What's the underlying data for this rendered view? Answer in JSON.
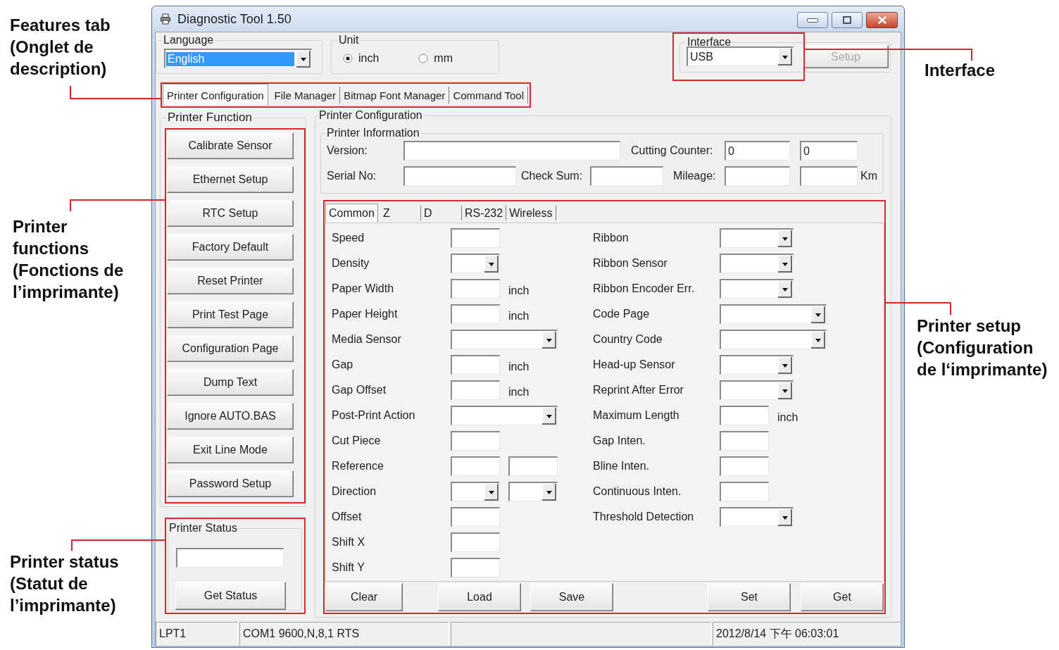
{
  "window": {
    "title": "Diagnostic Tool 1.50"
  },
  "language": {
    "label": "Language",
    "value": "English"
  },
  "unit": {
    "label": "Unit",
    "options": [
      {
        "label": "inch",
        "selected": true
      },
      {
        "label": "mm",
        "selected": false
      }
    ]
  },
  "interface": {
    "label": "Interface",
    "value": "USB",
    "setup_button": {
      "label": "Setup",
      "disabled": true
    }
  },
  "tabs": [
    {
      "label": "Printer Configuration",
      "selected": true
    },
    {
      "label": "File Manager",
      "selected": false
    },
    {
      "label": "Bitmap Font Manager",
      "selected": false
    },
    {
      "label": "Command Tool",
      "selected": false
    }
  ],
  "printer_function": {
    "title": "Printer Function",
    "buttons": [
      "Calibrate Sensor",
      "Ethernet Setup",
      "RTC Setup",
      "Factory Default",
      "Reset Printer",
      "Print Test Page",
      "Configuration Page",
      "Dump Text",
      "Ignore AUTO.BAS",
      "Exit Line Mode",
      "Password Setup"
    ]
  },
  "printer_status": {
    "title": "Printer Status",
    "button": "Get Status"
  },
  "printer_configuration": {
    "title": "Printer Configuration",
    "printer_information": {
      "title": "Printer Information",
      "version": {
        "label": "Version:"
      },
      "cutting_counter": {
        "label": "Cutting Counter:",
        "values": [
          "0",
          "0"
        ]
      },
      "serial_no": {
        "label": "Serial No:"
      },
      "check_sum": {
        "label": "Check Sum:"
      },
      "mileage": {
        "label": "Mileage:",
        "unit": "Km"
      }
    },
    "tabs": [
      {
        "label": "Common",
        "selected": true
      },
      {
        "label": "Z",
        "selected": false
      },
      {
        "label": "D",
        "selected": false
      },
      {
        "label": "RS-232",
        "selected": false
      },
      {
        "label": "Wireless",
        "selected": false
      }
    ],
    "common": {
      "left": [
        {
          "label": "Speed",
          "kind": "text"
        },
        {
          "label": "Density",
          "kind": "dropdown"
        },
        {
          "label": "Paper Width",
          "kind": "text",
          "unit": "inch"
        },
        {
          "label": "Paper Height",
          "kind": "text",
          "unit": "inch"
        },
        {
          "label": "Media Sensor",
          "kind": "wide_dropdown"
        },
        {
          "label": "Gap",
          "kind": "text",
          "unit": "inch"
        },
        {
          "label": "Gap Offset",
          "kind": "text",
          "unit": "inch"
        },
        {
          "label": "Post-Print Action",
          "kind": "wide_dropdown"
        },
        {
          "label": "Cut Piece",
          "kind": "text"
        },
        {
          "label": "Reference",
          "kind": "text_pair"
        },
        {
          "label": "Direction",
          "kind": "dropdown_pair"
        },
        {
          "label": "Offset",
          "kind": "text"
        },
        {
          "label": "Shift X",
          "kind": "text"
        },
        {
          "label": "Shift Y",
          "kind": "text"
        }
      ],
      "right": [
        {
          "label": "Ribbon",
          "kind": "dropdown"
        },
        {
          "label": "Ribbon Sensor",
          "kind": "dropdown"
        },
        {
          "label": "Ribbon Encoder Err.",
          "kind": "dropdown"
        },
        {
          "label": "Code Page",
          "kind": "wide_dropdown"
        },
        {
          "label": "Country Code",
          "kind": "wide_dropdown"
        },
        {
          "label": "Head-up Sensor",
          "kind": "dropdown"
        },
        {
          "label": "Reprint After Error",
          "kind": "dropdown"
        },
        {
          "label": "Maximum Length",
          "kind": "text",
          "unit": "inch"
        },
        {
          "label": "Gap Inten.",
          "kind": "text"
        },
        {
          "label": "Bline Inten.",
          "kind": "text"
        },
        {
          "label": "Continuous Inten.",
          "kind": "text"
        },
        {
          "label": "Threshold Detection",
          "kind": "dropdown"
        }
      ]
    },
    "buttons": [
      "Clear",
      "Load",
      "Save",
      "Set",
      "Get"
    ]
  },
  "status_bar": {
    "port": "LPT1",
    "serial": "COM1 9600,N,8,1 RTS",
    "datetime": "2012/8/14 下午 06:03:01"
  },
  "callouts": [
    "Features tab\n(Onglet de\ndescription)",
    "Interface",
    "Printer\nfunctions\n(Fonctions de\nl’imprimante)",
    "Printer setup\n(Configuration\nde l‘imprimante)",
    "Printer status\n(Statut de\nl’imprimante)"
  ]
}
